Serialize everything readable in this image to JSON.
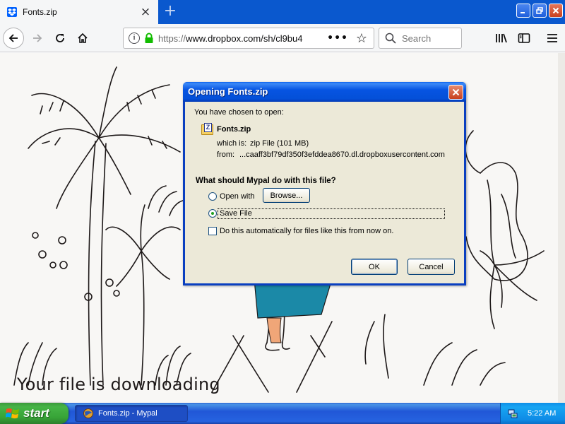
{
  "browser": {
    "tab": {
      "title": "Fonts.zip"
    },
    "url": {
      "scheme": "https://",
      "rest": "www.dropbox.com/sh/cl9bu4"
    },
    "search": {
      "placeholder": "Search"
    }
  },
  "page": {
    "heading": "Your file is downloading"
  },
  "dialog": {
    "title": "Opening Fonts.zip",
    "intro": "You have chosen to open:",
    "file_name": "Fonts.zip",
    "which_is_label": "which is:",
    "which_is_value": "zip File (101 MB)",
    "from_label": "from:",
    "from_value": "...caaff3bf79df350f3efddea8670.dl.dropboxusercontent.com",
    "question": "What should Mypal do with this file?",
    "open_with_label": "Open with",
    "browse_label": "Browse...",
    "save_file_label": "Save File",
    "selected_option": "save",
    "auto_label": "Do this automatically for files like this from now on.",
    "auto_checked": false,
    "ok_label": "OK",
    "cancel_label": "Cancel"
  },
  "taskbar": {
    "start_label": "start",
    "task_label": "Fonts.zip - Mypal",
    "clock": "5:22 AM"
  }
}
